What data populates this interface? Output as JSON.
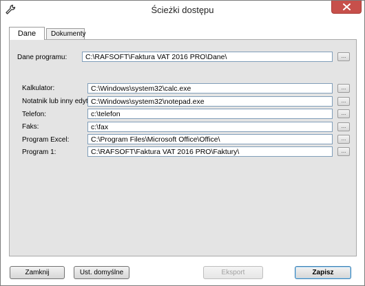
{
  "window": {
    "title": "Ścieżki dostępu",
    "close_icon": "close-icon",
    "app_icon": "wrench-icon"
  },
  "tabs": [
    {
      "label": "Dane",
      "active": true
    },
    {
      "label": "Dokumenty",
      "active": false
    }
  ],
  "program": {
    "label": "Dane programu:",
    "value": "C:\\RAFSOFT\\Faktura VAT 2016 PRO\\Dane\\",
    "browse_label": "..."
  },
  "paths": [
    {
      "label": "Kalkulator:",
      "value": "C:\\Windows\\system32\\calc.exe"
    },
    {
      "label": "Notatnik lub inny edytor:",
      "value": "C:\\Windows\\system32\\notepad.exe"
    },
    {
      "label": "Telefon:",
      "value": "c:\\telefon"
    },
    {
      "label": "Faks:",
      "value": "c:\\fax"
    },
    {
      "label": "Program Excel:",
      "value": "C:\\Program Files\\Microsoft Office\\Office\\"
    },
    {
      "label": "Program 1:",
      "value": "C:\\RAFSOFT\\Faktura VAT 2016 PRO\\Faktury\\"
    }
  ],
  "browse_label": "...",
  "buttons": {
    "close": "Zamknij",
    "defaults": "Ust. domyślne",
    "export": "Eksport",
    "save": "Zapisz"
  },
  "colors": {
    "close_button": "#c7504b",
    "panel": "#e4e4e4",
    "save_focus": "#3c7fb1"
  }
}
